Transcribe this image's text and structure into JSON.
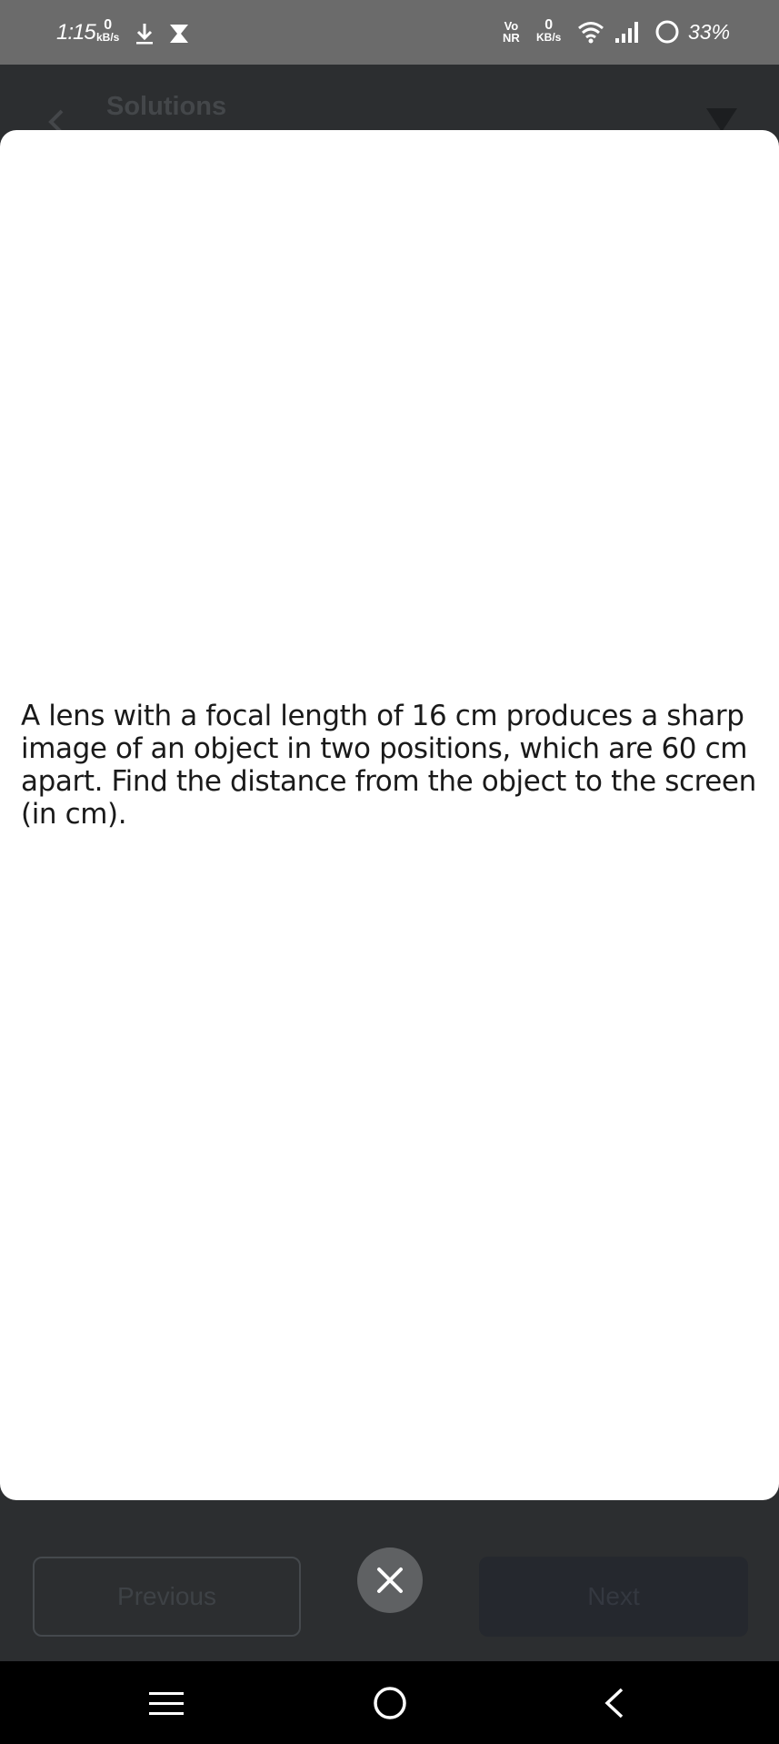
{
  "status_bar": {
    "time": "1:15",
    "net_speed_left_value": "0",
    "net_speed_left_unit": "kB/s",
    "vonr_top": "Vo",
    "vonr_bottom": "NR",
    "net_speed_right_value": "0",
    "net_speed_right_unit": "KB/s",
    "battery_percent": "33%"
  },
  "header": {
    "title": "Solutions"
  },
  "modal": {
    "question_text": "A lens with a focal length of 16 cm produces a sharp image of an object in two positions, which are 60 cm apart. Find the distance from the object to the screen (in cm)."
  },
  "footer": {
    "previous_label": "Previous",
    "next_label": "Next"
  },
  "icons": {
    "download": "download-icon",
    "hourglass": "hourglass-icon",
    "wifi": "wifi-icon",
    "signal": "signal-icon",
    "battery": "battery-icon",
    "back": "back-icon",
    "filter": "filter-icon",
    "close": "close-icon",
    "nav_menu": "menu-icon",
    "nav_home": "home-icon",
    "nav_back": "back-icon"
  }
}
